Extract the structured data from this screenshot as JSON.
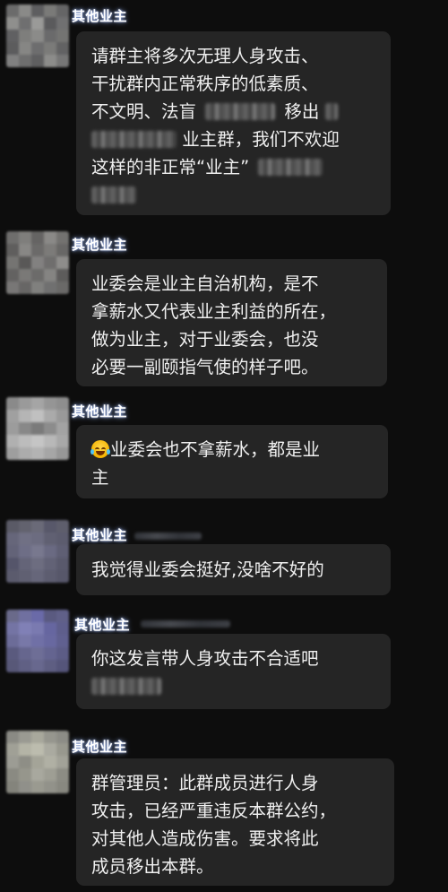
{
  "messages": [
    {
      "sender": "其他业主",
      "avatar_colors": [
        "#6b6b6b",
        "#8a8a88",
        "#5e5e60",
        "#7a7a78",
        "#656566",
        "#8f8f8d",
        "#6f6f70",
        "#9a9a98",
        "#5a5a5c",
        "#707071",
        "#606062",
        "#7e7e7c",
        "#8b8b89",
        "#6a6a6b",
        "#747472",
        "#5c5c5d",
        "#868684",
        "#6d6d6e",
        "#7b7b79",
        "#626263",
        "#808080",
        "#6e6e6e",
        "#5f5f60",
        "#8c8c8a",
        "#767676"
      ],
      "lines": [
        [
          "请群主将多次无理人身攻击、"
        ],
        [
          "干扰群内正常秩序的低素质、"
        ],
        [
          "不文明、法盲",
          "[blurred]",
          "移出"
        ],
        [
          "[blurred]",
          "业主群，我们不欢迎"
        ],
        [
          "这样的非正常“业主”",
          "[blurred]"
        ],
        [
          "[blurred]"
        ]
      ]
    },
    {
      "sender": "其他业主",
      "avatar_colors": [
        "#6e6d6c",
        "#7f7e7c",
        "#656463",
        "#8a8987",
        "#737270",
        "#5f5e5d",
        "#888785",
        "#6b6a69",
        "#7c7b79",
        "#686766",
        "#757472",
        "#595857",
        "#828180",
        "#6f6e6d",
        "#8e8d8b",
        "#636261",
        "#7a7977",
        "#6c6b6a",
        "#858482",
        "#5d5c5b",
        "#787776",
        "#676665",
        "#80807e",
        "#707070",
        "#6a6968"
      ],
      "lines": [
        [
          "业委会是业主自治机构，是不"
        ],
        [
          "拿薪水又代表业主利益的所在，"
        ],
        [
          "做为业主，对于业委会，也没"
        ],
        [
          "必要一副颐指气使的样子吧。"
        ]
      ]
    },
    {
      "sender": "其他业主",
      "avatar_colors": [
        "#8a8a8a",
        "#9a9a9a",
        "#a5a5a5",
        "#959595",
        "#8e8e8e",
        "#a0a0a0",
        "#b5b5b5",
        "#c0c0c0",
        "#aaaaaa",
        "#999999",
        "#9c9c9c",
        "#888888",
        "#7a7a7a",
        "#8c8c8c",
        "#a3a3a3",
        "#b0b0b0",
        "#bcbcbc",
        "#c5c5c5",
        "#b8b8b8",
        "#a8a8a8",
        "#9e9e9e",
        "#acacac",
        "#b3b3b3",
        "#a6a6a6",
        "#979797"
      ],
      "lines": [
        [
          "[emoji]",
          "业委会也不拿薪水，都是业"
        ],
        [
          "主"
        ]
      ]
    },
    {
      "sender": "其他业主",
      "avatar_colors": [
        "#5a5a66",
        "#62626e",
        "#6a6a78",
        "#58586a",
        "#5e5e6c",
        "#66667a",
        "#707084",
        "#6c6c80",
        "#606072",
        "#5c5c6e",
        "#636378",
        "#6e6e86",
        "#78788e",
        "#6a6a82",
        "#5f5f74",
        "#55556a",
        "#646478",
        "#6d6d80",
        "#626276",
        "#59596c",
        "#5b5b6d",
        "#606072",
        "#66667a",
        "#5d5d70",
        "#57576a"
      ],
      "lines": [
        [
          "我觉得业委会挺好,没啥不好的"
        ]
      ]
    },
    {
      "sender": "其他业主",
      "avatar_colors": [
        "#6a6a8a",
        "#7070a0",
        "#6a6aa8",
        "#5a5a80",
        "#606088",
        "#7474a4",
        "#8080b6",
        "#7a7ab0",
        "#6666a0",
        "#5e5e8c",
        "#6c6c98",
        "#7878a8",
        "#7070a6",
        "#6868a0",
        "#606090",
        "#5a5a7e",
        "#66668e",
        "#6e6e96",
        "#646490",
        "#5c5c86",
        "#585878",
        "#606084",
        "#68688e",
        "#5e5e82",
        "#55557a"
      ],
      "lines": [
        [
          "你这发言带人身攻击不合适吧"
        ],
        [
          "[blurred]"
        ]
      ]
    },
    {
      "sender": "其他业主",
      "avatar_colors": [
        "#8a8a84",
        "#9a9a92",
        "#a8a89c",
        "#96968e",
        "#8c8c86",
        "#a0a096",
        "#b4b4a6",
        "#bcbcae",
        "#aaaaa0",
        "#98988e",
        "#9c9c94",
        "#8e8e86",
        "#a4a498",
        "#b0b0a4",
        "#a2a298",
        "#8a8a82",
        "#96968c",
        "#a8a89e",
        "#9e9e94",
        "#8c8c84",
        "#84847c",
        "#90908a",
        "#9a9a90",
        "#92928a",
        "#888880"
      ],
      "lines": [
        [
          "群管理员：此群成员进行人身"
        ],
        [
          "攻击，已经严重违反本群公约，"
        ],
        [
          "对其他人造成伤害。要求将此"
        ],
        [
          "成员移出本群。"
        ]
      ]
    }
  ]
}
